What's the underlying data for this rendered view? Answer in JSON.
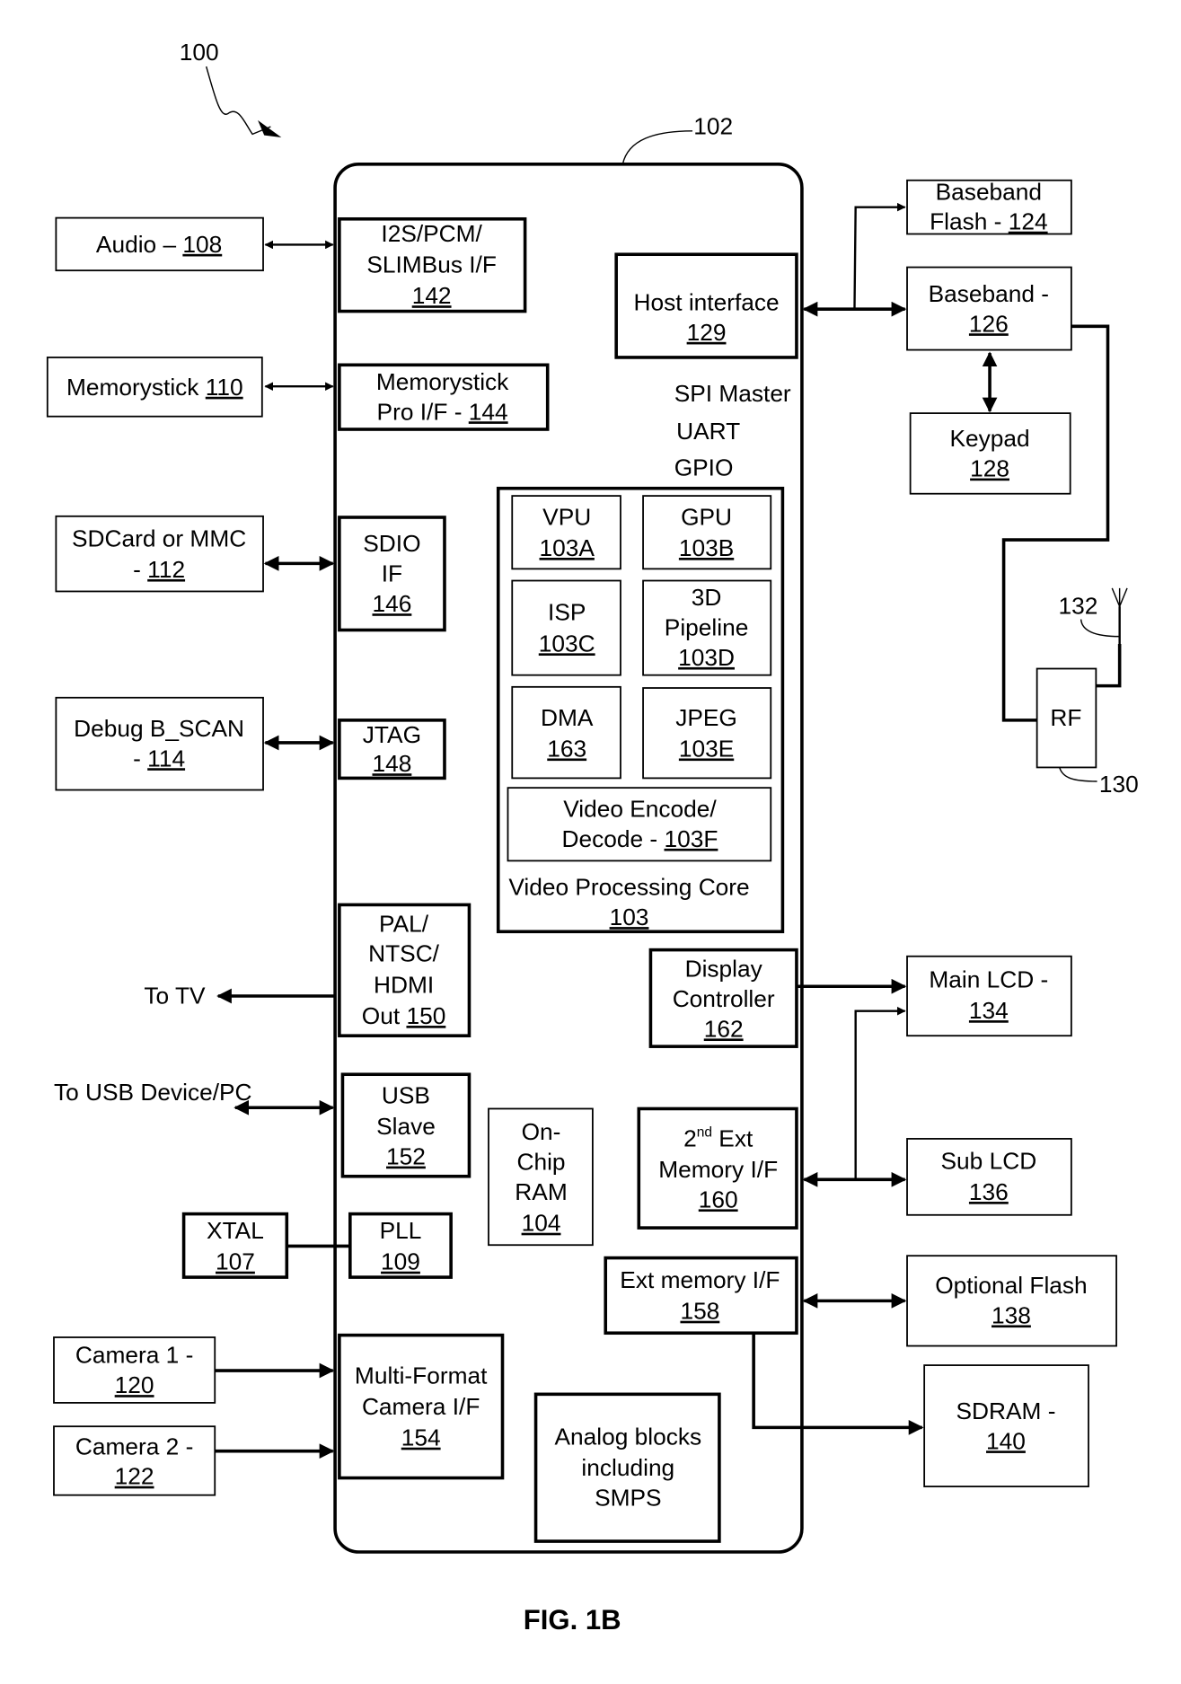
{
  "figure": {
    "caption": "FIG. 1B",
    "system_ref": "100",
    "chip_ref": "102",
    "antenna_ref": "132",
    "rf_ref": "130"
  },
  "external": {
    "audio": {
      "label": "Audio – ",
      "ref": "108"
    },
    "memorystick": {
      "label": "Memorystick ",
      "ref": "110"
    },
    "sdcard": {
      "line1": "SDCard or MMC",
      "line2": "- ",
      "ref": "112"
    },
    "debug": {
      "line1": "Debug B_SCAN",
      "line2": "- ",
      "ref": "114"
    },
    "to_tv": "To TV",
    "to_usb": "To USB Device/PC",
    "xtal": {
      "label": "XTAL",
      "ref": "107"
    },
    "camera1": {
      "label": "Camera 1 -",
      "ref": "120"
    },
    "camera2": {
      "label": "Camera 2 -",
      "ref": "122"
    },
    "baseband_flash": {
      "line1": "Baseband",
      "line2": "Flash - ",
      "ref": "124"
    },
    "baseband": {
      "label": "Baseband -",
      "ref": "126"
    },
    "keypad": {
      "label": "Keypad",
      "ref": "128"
    },
    "rf": {
      "label": "RF"
    },
    "main_lcd": {
      "label": "Main LCD -",
      "ref": "134"
    },
    "sub_lcd": {
      "label": "Sub LCD",
      "ref": "136"
    },
    "optional_flash": {
      "label": "Optional Flash",
      "ref": "138"
    },
    "sdram": {
      "label": "SDRAM -",
      "ref": "140"
    }
  },
  "internal": {
    "i2s": {
      "line1": "I2S/PCM/",
      "line2": "SLIMBus I/F",
      "ref": "142"
    },
    "mspro": {
      "line1": "Memorystick",
      "line2": "Pro I/F - ",
      "ref": "144"
    },
    "sdio": {
      "line1": "SDIO",
      "line2": "IF",
      "ref": "146"
    },
    "jtag": {
      "label": "JTAG",
      "ref": "148"
    },
    "palntsc": {
      "line1": "PAL/",
      "line2": "NTSC/",
      "line3": "HDMI",
      "line4": "Out ",
      "ref": "150"
    },
    "usb": {
      "line1": "USB",
      "line2": "Slave",
      "ref": "152"
    },
    "pll": {
      "label": "PLL",
      "ref": "109"
    },
    "camif": {
      "line1": "Multi-Format",
      "line2": "Camera I/F",
      "ref": "154"
    },
    "onchip_ram": {
      "line1": "On-",
      "line2": "Chip",
      "line3": "RAM",
      "ref": "104"
    },
    "analog": {
      "line1": "Analog blocks",
      "line2": "including",
      "line3": "SMPS"
    },
    "host": {
      "label": "Host interface",
      "ref": "129"
    },
    "spi": "SPI Master",
    "uart": "UART",
    "gpio": "GPIO",
    "vpc": {
      "label": "Video Processing Core",
      "ref": "103"
    },
    "vpu": {
      "label": "VPU",
      "ref": "103A"
    },
    "gpu": {
      "label": "GPU",
      "ref": "103B"
    },
    "isp": {
      "label": "ISP",
      "ref": "103C"
    },
    "pipeline": {
      "line1": "3D",
      "line2": "Pipeline",
      "ref": "103D"
    },
    "dma": {
      "label": "DMA",
      "ref": "163"
    },
    "jpeg": {
      "label": "JPEG",
      "ref": "103E"
    },
    "video_codec": {
      "line1": "Video Encode/",
      "line2": "Decode - ",
      "ref": "103F"
    },
    "display_ctrl": {
      "line1": "Display",
      "line2": "Controller",
      "ref": "162"
    },
    "ext_mem2": {
      "line1": "2",
      "sup": "nd",
      "line1b": " Ext",
      "line2": "Memory I/F",
      "ref": "160"
    },
    "ext_mem": {
      "label": "Ext memory I/F",
      "ref": "158"
    }
  }
}
